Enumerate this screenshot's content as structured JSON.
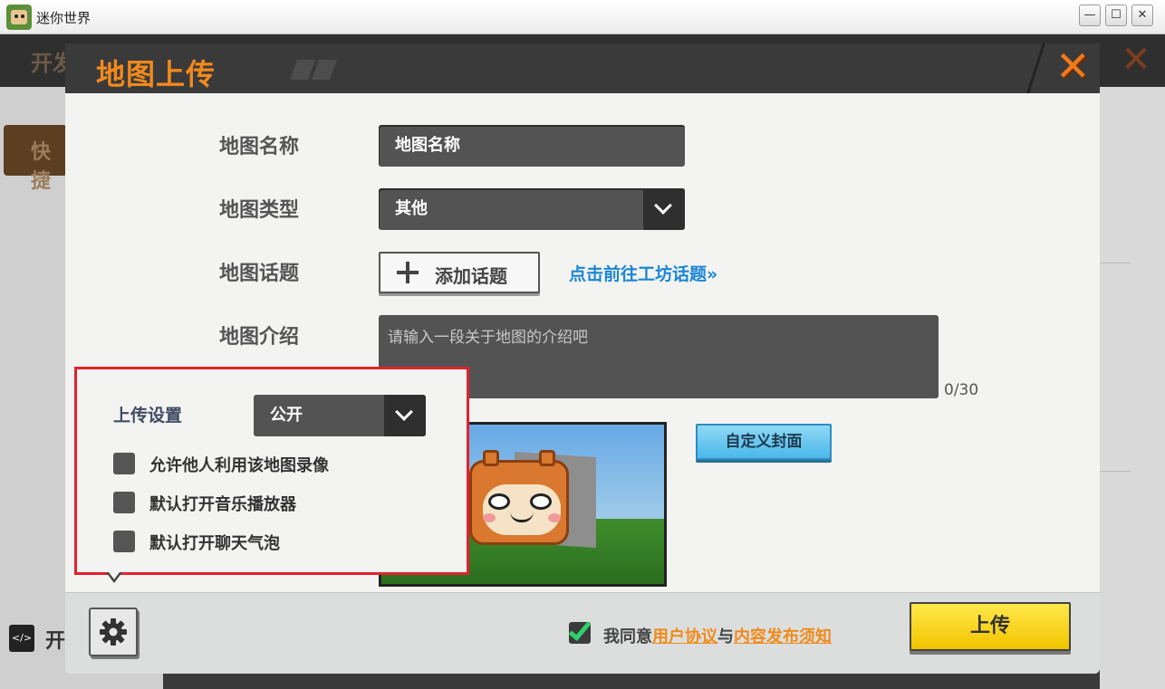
{
  "window": {
    "title": "迷你世界",
    "minimize": "—",
    "maximize": "☐",
    "close": "✕"
  },
  "background": {
    "tab_label": "开发",
    "quick_label": "快捷",
    "dev_label": "开",
    "dev_icon_glyph": "</>",
    "close_glyph": "✕"
  },
  "dialog": {
    "title": "地图上传",
    "close_glyph": "✕",
    "fields": {
      "name_label": "地图名称",
      "name_value": "地图名称",
      "type_label": "地图类型",
      "type_value": "其他",
      "topic_label": "地图话题",
      "topic_button": "添加话题",
      "topic_link": "点击前往工坊话题»",
      "intro_label": "地图介绍",
      "intro_placeholder": "请输入一段关于地图的介绍吧",
      "intro_counter": "0/30"
    },
    "cover": {
      "custom_button": "自定义封面"
    },
    "footer": {
      "agree_checked": true,
      "agree_prefix": "我同意",
      "user_agreement": "用户协议",
      "and": "与",
      "content_notice": "内容发布须知",
      "upload_button": "上传"
    }
  },
  "upload_settings": {
    "label": "上传设置",
    "visibility": "公开",
    "options": [
      {
        "label": "允许他人利用该地图录像",
        "checked": false
      },
      {
        "label": "默认打开音乐播放器",
        "checked": false
      },
      {
        "label": "默认打开聊天气泡",
        "checked": false
      }
    ]
  },
  "colors": {
    "accent_orange": "#f28a1e",
    "link_blue": "#1a86d4",
    "highlight_red": "#e2222c",
    "upload_yellow": "#f2c400",
    "check_green": "#2fd16c"
  }
}
